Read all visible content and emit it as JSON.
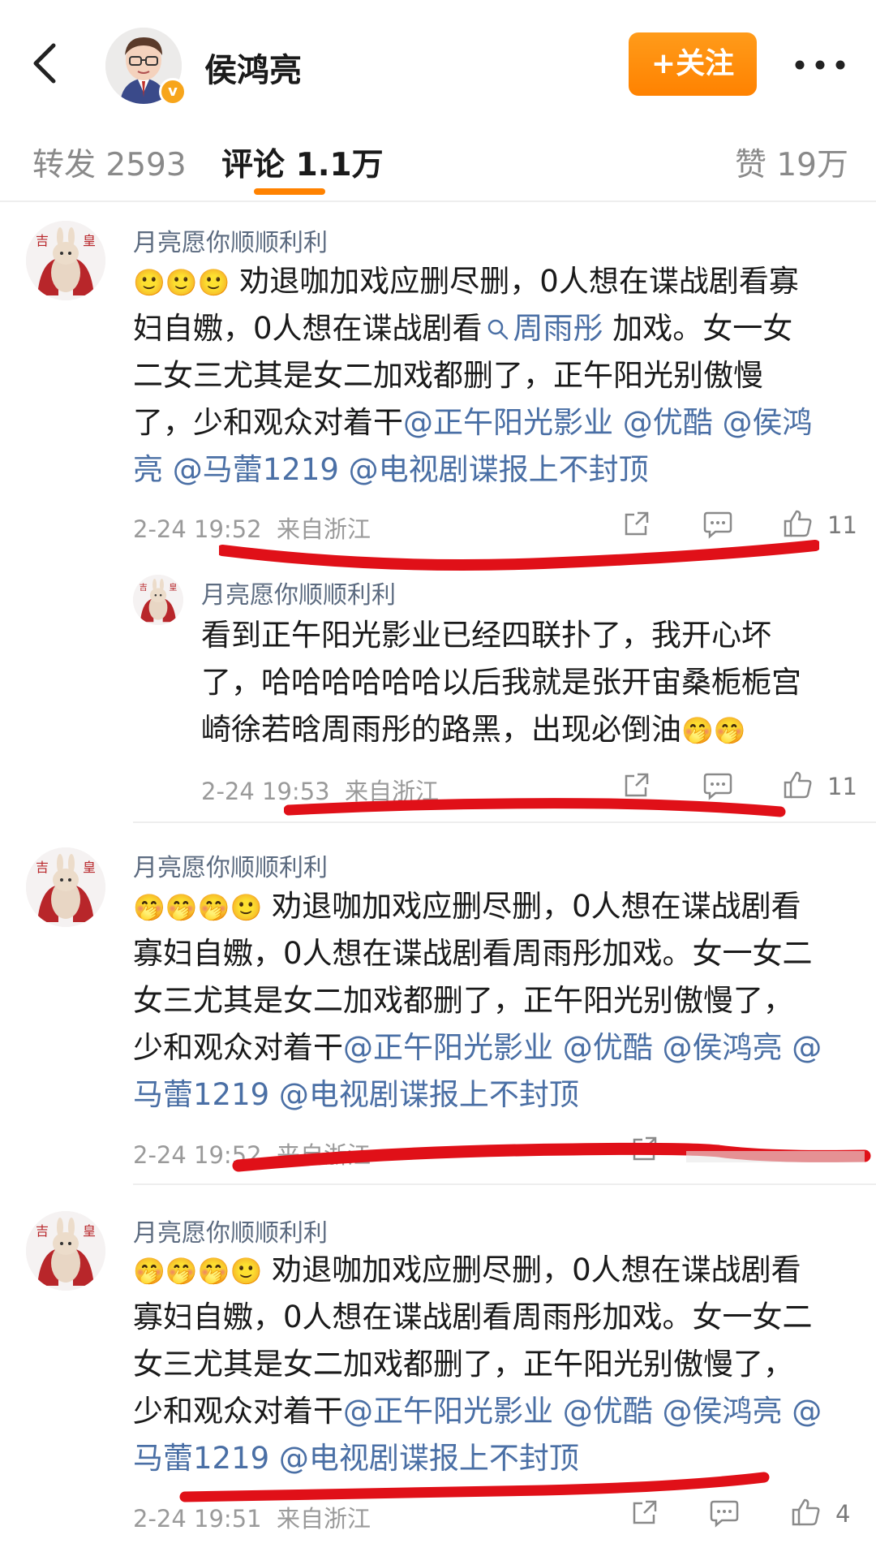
{
  "header": {
    "name": "侯鸿亮",
    "follow_label": "+关注",
    "verified_badge": "v"
  },
  "tabs": {
    "repost": "转发 2593",
    "comments": "评论 1.1万",
    "likes": "赞 19万"
  },
  "colors": {
    "accent": "#ff8200",
    "link": "#4a6fa5",
    "marker": "#e01018"
  },
  "comments": [
    {
      "username": "月亮愿你顺顺利利",
      "emoji": "🙂🙂🙂",
      "text_a": " 劝退咖加戏应删尽删，0人想在谍战剧看寡",
      "text_b": "妇自嫐，0人想在谍战剧看",
      "search_link": "周雨彤",
      "text_c": " 加戏。女一女",
      "text_d": "二女三尤其是女二加戏都删了，正午阳光别傲慢",
      "text_e": "了，少和观众对着干",
      "mention_line4": "@正午阳光影业 @优酷 @侯鸿",
      "mention_line5": "亮 @马蕾1219 @电视剧谍报上不封顶",
      "time": "2-24 19:52",
      "location": "来自浙江",
      "like_count": "11"
    },
    {
      "username": "月亮愿你顺顺利利",
      "line1": "看到正午阳光影业已经四联扑了，我开心坏",
      "line2": "了，哈哈哈哈哈哈以后我就是张开宙桑栀栀宫",
      "line3": "崎徐若晗周雨彤的路黑，出现必倒油",
      "emoji": "🤭🤭",
      "time": "2-24 19:53",
      "location": "来自浙江",
      "like_count": "11"
    },
    {
      "username": "月亮愿你顺顺利利",
      "emoji": "🤭🤭🤭🙂",
      "line1": " 劝退咖加戏应删尽删，0人想在谍战剧看",
      "line2": "寡妇自嫐，0人想在谍战剧看周雨彤加戏。女一女二",
      "line3": "女三尤其是女二加戏都删了，正午阳光别傲慢了，",
      "line4_text": "少和观众对着干",
      "line4_mention": "@正午阳光影业 @优酷 @侯鸿亮 @",
      "line5_mention": "马蕾1219 @电视剧谍报上不封顶",
      "time": "2-24 19:52",
      "location": "来自浙江"
    },
    {
      "username": "月亮愿你顺顺利利",
      "emoji": "🤭🤭🤭🙂",
      "line1": " 劝退咖加戏应删尽删，0人想在谍战剧看",
      "line2": "寡妇自嫐，0人想在谍战剧看周雨彤加戏。女一女二",
      "line3": "女三尤其是女二加戏都删了，正午阳光别傲慢了，",
      "line4_text": "少和观众对着干",
      "line4_mention": "@正午阳光影业 @优酷 @侯鸿亮 @",
      "line5_mention": "马蕾1219 @电视剧谍报上不封顶",
      "time": "2-24 19:51",
      "location": "来自浙江",
      "like_count": "4"
    }
  ]
}
